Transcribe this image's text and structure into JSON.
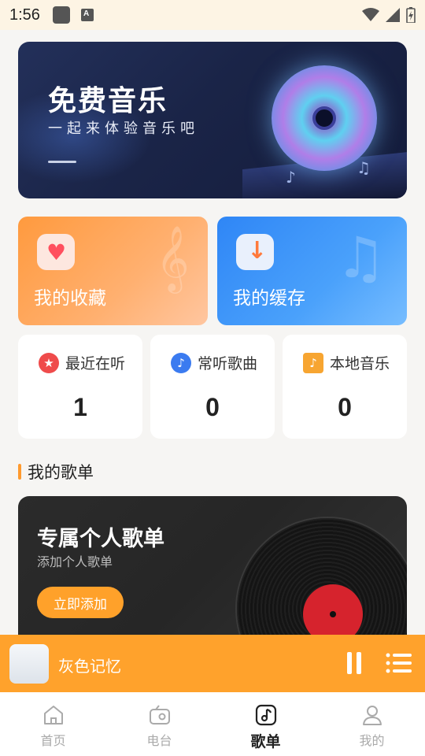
{
  "status_bar": {
    "time": "1:56"
  },
  "banner": {
    "title": "免费音乐",
    "subtitle": "一起来体验音乐吧"
  },
  "quick_cards": [
    {
      "label": "我的收藏",
      "icon": "heart-chat-icon",
      "color": "#ff9a3e"
    },
    {
      "label": "我的缓存",
      "icon": "download-icon",
      "color": "#2f86f6"
    }
  ],
  "stats": [
    {
      "label": "最近在听",
      "value": "1",
      "icon": "star-icon",
      "icon_color": "#ef4b4b"
    },
    {
      "label": "常听歌曲",
      "value": "0",
      "icon": "music-note-icon",
      "icon_color": "#3b7bf0"
    },
    {
      "label": "本地音乐",
      "value": "0",
      "icon": "folder-icon",
      "icon_color": "#f7a531"
    }
  ],
  "section": {
    "title": "我的歌单"
  },
  "playlist_card": {
    "title": "专属个人歌单",
    "subtitle": "添加个人歌单",
    "button": "立即添加"
  },
  "player": {
    "song": "灰色记忆"
  },
  "tabs": [
    {
      "label": "首页",
      "icon": "home-icon",
      "active": false
    },
    {
      "label": "电台",
      "icon": "radio-icon",
      "active": false
    },
    {
      "label": "歌单",
      "icon": "playlist-icon",
      "active": true
    },
    {
      "label": "我的",
      "icon": "user-icon",
      "active": false
    }
  ],
  "colors": {
    "accent": "#ffa22c",
    "background": "#f6f5f3"
  }
}
